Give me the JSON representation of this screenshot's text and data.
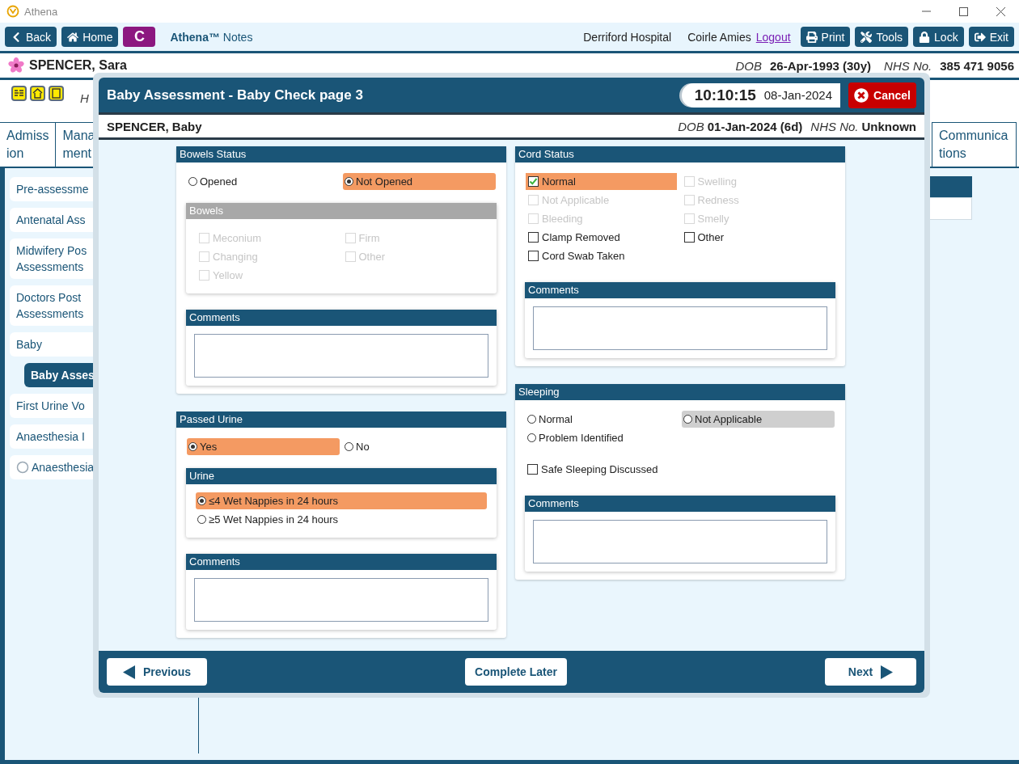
{
  "window": {
    "title": "Athena"
  },
  "toolbar": {
    "left_buttons": [
      {
        "kind": "back",
        "label": "Back"
      },
      {
        "kind": "home",
        "label": "Home"
      }
    ],
    "app_badge": "C",
    "app_name": "**Athena™** Notes",
    "hospital": "Derriford Hospital",
    "user": "Coirle Amies",
    "logout": "Logout",
    "right_buttons": [
      {
        "kind": "print",
        "label": "Print"
      },
      {
        "kind": "tools",
        "label": "Tools"
      },
      {
        "kind": "lock",
        "label": "Lock"
      },
      {
        "kind": "exit",
        "label": "Exit"
      }
    ]
  },
  "patient": {
    "name": "SPENCER, Sara",
    "dob_label": "DOB",
    "dob": "26-Apr-1993 (30y)",
    "nhs_label": "NHS No.",
    "nhs": "385 471 9056"
  },
  "alerts": {
    "note": "H"
  },
  "tabs": {
    "left": [
      {
        "lines": [
          "Admiss",
          "ion"
        ]
      },
      {
        "lines": [
          "Mana",
          "ment"
        ]
      }
    ],
    "right": [
      {
        "lines": [
          "Communica",
          "tions"
        ]
      }
    ]
  },
  "sidebar": {
    "items": [
      {
        "lines": [
          "Pre-assessme"
        ],
        "kind": "plain",
        "selected": false
      },
      {
        "lines": [
          "Antenatal Ass"
        ],
        "kind": "plain",
        "selected": false
      },
      {
        "lines": [
          "Midwifery Pos",
          "Assessments"
        ],
        "kind": "plain",
        "selected": false
      },
      {
        "lines": [
          "Doctors Post",
          "Assessments"
        ],
        "kind": "plain",
        "selected": false
      },
      {
        "lines": [
          "Baby"
        ],
        "kind": "plain",
        "selected": false,
        "children": [
          {
            "lines": [
              "Baby Asses"
            ],
            "kind": "plain",
            "selected": true
          }
        ]
      },
      {
        "lines": [
          "First Urine Vo"
        ],
        "kind": "plain",
        "selected": false
      },
      {
        "lines": [
          "Anaesthesia I"
        ],
        "kind": "plain",
        "selected": false
      },
      {
        "lines": [
          "Anaesthesia"
        ],
        "kind": "circle",
        "selected": false
      }
    ]
  },
  "modal": {
    "title": "Baby Assessment - Baby Check page 3",
    "time": "10:10:15",
    "date": "08-Jan-2024",
    "cancel": "Cancel",
    "baby": {
      "name": "SPENCER, Baby",
      "dob_label": "DOB",
      "dob": "01-Jan-2024 (6d)",
      "nhs_label": "NHS No.",
      "nhs": "Unknown"
    },
    "columns": [
      {
        "panels": [
          {
            "title": "Bowels Status",
            "items": [
              {
                "kind": "radios",
                "options": [
                  {
                    "label": "Opened",
                    "selected": false,
                    "shaded": false
                  },
                  {
                    "label": "Not Opened",
                    "selected": true,
                    "shaded": false
                  }
                ]
              },
              {
                "kind": "subpanel",
                "title": "Bowels",
                "disabled": true,
                "items": [
                  {
                    "kind": "checks",
                    "options": [
                      {
                        "label": "Meconium",
                        "checked": false,
                        "disabled": true
                      },
                      {
                        "label": "Firm",
                        "checked": false,
                        "disabled": true
                      },
                      {
                        "label": "Changing",
                        "checked": false,
                        "disabled": true
                      },
                      {
                        "label": "Other",
                        "checked": false,
                        "disabled": true
                      },
                      {
                        "label": "Yellow",
                        "checked": false,
                        "disabled": true
                      }
                    ]
                  }
                ]
              },
              {
                "kind": "comments",
                "title": "Comments"
              }
            ]
          },
          {
            "title": "Passed Urine",
            "items": [
              {
                "kind": "radios",
                "options": [
                  {
                    "label": "Yes",
                    "selected": true,
                    "shaded": false
                  },
                  {
                    "label": "No",
                    "selected": false,
                    "shaded": false
                  }
                ]
              },
              {
                "kind": "subpanel",
                "title": "Urine",
                "disabled": false,
                "items": [
                  {
                    "kind": "radio_list",
                    "options": [
                      {
                        "label": "≤4 Wet Nappies in 24 hours",
                        "selected": true,
                        "shaded": false
                      },
                      {
                        "label": "≥5 Wet Nappies in 24 hours",
                        "selected": false,
                        "shaded": false
                      }
                    ]
                  }
                ]
              },
              {
                "kind": "comments",
                "title": "Comments"
              }
            ]
          }
        ]
      },
      {
        "panels": [
          {
            "title": "Cord Status",
            "items": [
              {
                "kind": "checks",
                "options": [
                  {
                    "label": "Normal",
                    "checked": true,
                    "disabled": false
                  },
                  {
                    "label": "Swelling",
                    "checked": false,
                    "disabled": true
                  },
                  {
                    "label": "Not Applicable",
                    "checked": false,
                    "disabled": true
                  },
                  {
                    "label": "Redness",
                    "checked": false,
                    "disabled": true
                  },
                  {
                    "label": "Bleeding",
                    "checked": false,
                    "disabled": true
                  },
                  {
                    "label": "Smelly",
                    "checked": false,
                    "disabled": true
                  },
                  {
                    "label": "Clamp Removed",
                    "checked": false,
                    "disabled": false
                  },
                  {
                    "label": "Other",
                    "checked": false,
                    "disabled": false
                  },
                  {
                    "label": "Cord Swab Taken",
                    "checked": false,
                    "disabled": false
                  }
                ]
              },
              {
                "kind": "comments",
                "title": "Comments"
              }
            ]
          },
          {
            "title": "Sleeping",
            "items": [
              {
                "kind": "radios",
                "options": [
                  {
                    "label": "Normal",
                    "selected": false,
                    "shaded": false
                  },
                  {
                    "label": "Not Applicable",
                    "selected": false,
                    "shaded": true
                  },
                  {
                    "label": "Problem Identified",
                    "selected": false,
                    "shaded": false
                  }
                ]
              },
              {
                "kind": "checks",
                "options": [
                  {
                    "label": "Safe Sleeping Discussed",
                    "checked": false,
                    "disabled": false
                  }
                ]
              },
              {
                "kind": "comments",
                "title": "Comments"
              }
            ]
          }
        ]
      }
    ],
    "footer": [
      {
        "kind": "previous",
        "label": "Previous"
      },
      {
        "kind": "complete_later",
        "label": "Complete Later"
      },
      {
        "kind": "next",
        "label": "Next"
      }
    ]
  }
}
